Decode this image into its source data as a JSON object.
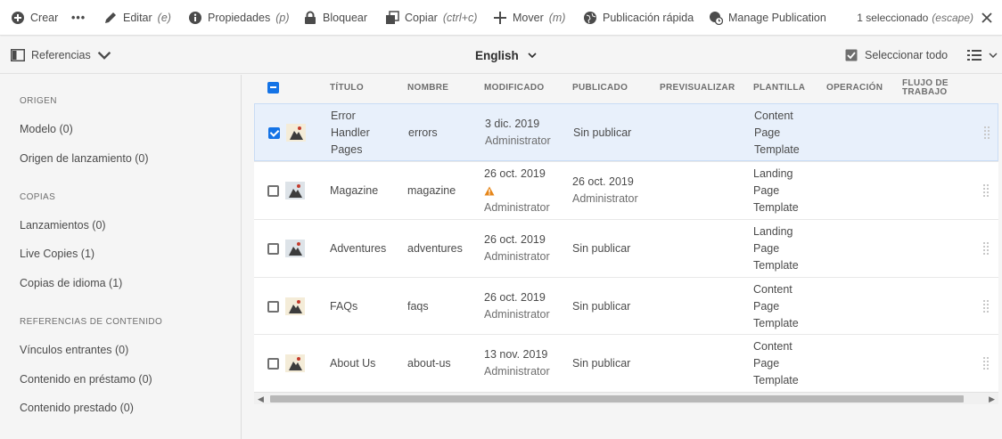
{
  "toolbar": {
    "create": "Crear",
    "more": "•••",
    "edit": "Editar",
    "edit_key": "(e)",
    "properties": "Propiedades",
    "properties_key": "(p)",
    "lock": "Bloquear",
    "copy": "Copiar",
    "copy_key": "(ctrl+c)",
    "move": "Mover",
    "move_key": "(m)",
    "quick_publish": "Publicación rápida",
    "manage_publication": "Manage Publication",
    "selection_count": "1 seleccionado",
    "escape_hint": "(escape)"
  },
  "subbar": {
    "rail_label": "Referencias",
    "language": "English",
    "select_all": "Seleccionar todo"
  },
  "rail": {
    "sections": [
      {
        "title": "ORIGEN",
        "items": [
          "Modelo (0)",
          "Origen de lanzamiento (0)"
        ]
      },
      {
        "title": "COPIAS",
        "items": [
          "Lanzamientos (0)",
          "Live Copies (1)",
          "Copias de idioma (1)"
        ]
      },
      {
        "title": "REFERENCIAS DE CONTENIDO",
        "items": [
          "Vínculos entrantes (0)",
          "Contenido en préstamo (0)",
          "Contenido prestado (0)"
        ]
      }
    ]
  },
  "table": {
    "headers": {
      "title": "TÍTULO",
      "name": "NOMBRE",
      "modified": "MODIFICADO",
      "published": "PUBLICADO",
      "preview": "PREVISUALIZAR",
      "template": "PLANTILLA",
      "operation": "OPERACIÓN",
      "workflow_1": "FLUJO DE",
      "workflow_2": "TRABAJO"
    },
    "rows": [
      {
        "selected": true,
        "title_lines": [
          "Error",
          "Handler",
          "Pages"
        ],
        "name": "errors",
        "modified": "3 dic. 2019",
        "modified_by": "Administrator",
        "warning": false,
        "published": "Sin publicar",
        "published_by": "",
        "template_lines": [
          "Content",
          "Page",
          "Template"
        ]
      },
      {
        "selected": false,
        "title_lines": [
          "Magazine"
        ],
        "name": "magazine",
        "modified": "26 oct. 2019",
        "modified_by": "Administrator",
        "warning": true,
        "published": "26 oct. 2019",
        "published_by": "Administrator",
        "template_lines": [
          "Landing",
          "Page",
          "Template"
        ]
      },
      {
        "selected": false,
        "title_lines": [
          "Adventures"
        ],
        "name": "adventures",
        "modified": "26 oct. 2019",
        "modified_by": "Administrator",
        "warning": false,
        "published": "Sin publicar",
        "published_by": "",
        "template_lines": [
          "Landing",
          "Page",
          "Template"
        ]
      },
      {
        "selected": false,
        "title_lines": [
          "FAQs"
        ],
        "name": "faqs",
        "modified": "26 oct. 2019",
        "modified_by": "Administrator",
        "warning": false,
        "published": "Sin publicar",
        "published_by": "",
        "template_lines": [
          "Content",
          "Page",
          "Template"
        ]
      },
      {
        "selected": false,
        "title_lines": [
          "About Us"
        ],
        "name": "about-us",
        "modified": "13 nov. 2019",
        "modified_by": "Administrator",
        "warning": false,
        "published": "Sin publicar",
        "published_by": "",
        "template_lines": [
          "Content",
          "Page",
          "Template"
        ]
      }
    ]
  },
  "colors": {
    "accent": "#1473e6",
    "selected_row": "#e8f0fb",
    "warning": "#e68619"
  },
  "icons": [
    "add-circle-icon",
    "edit-icon",
    "info-icon",
    "lock-icon",
    "copy-icon",
    "move-icon",
    "globe-icon",
    "clock-globe-icon",
    "close-icon",
    "rail-icon",
    "chevron-down-icon",
    "checkbox-icon",
    "list-view-icon",
    "warning-icon",
    "drag-handle-icon"
  ]
}
